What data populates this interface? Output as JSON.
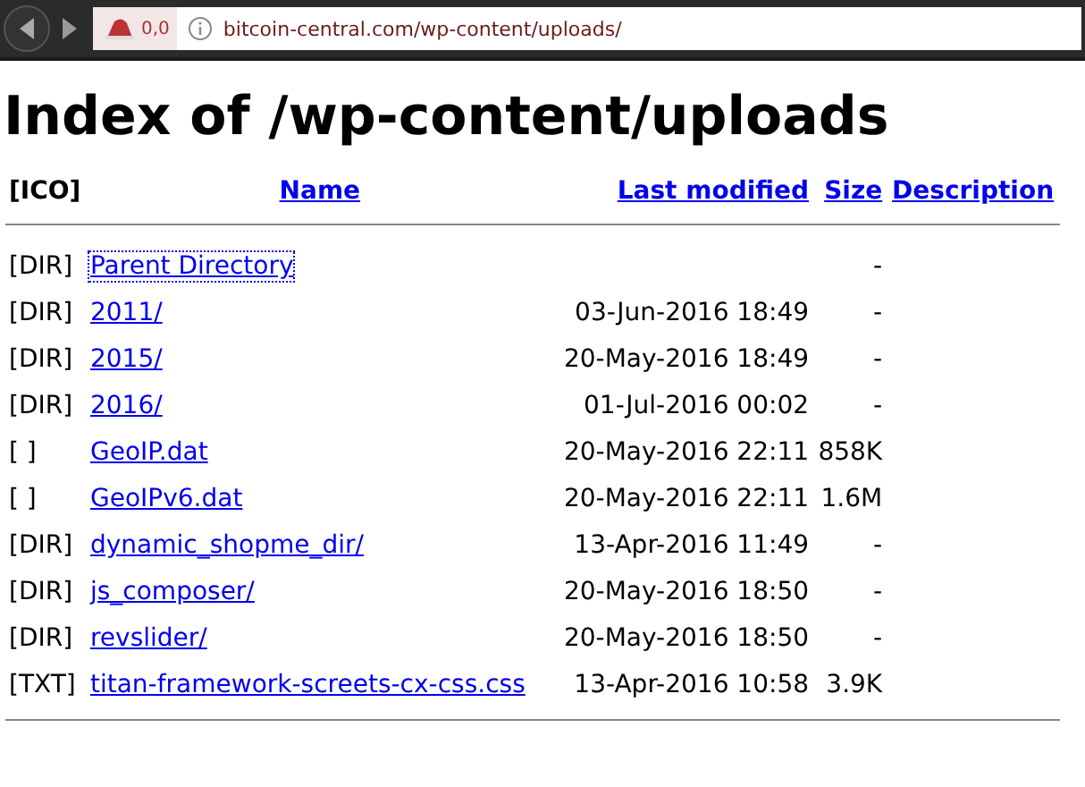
{
  "browser": {
    "counter": "0,0",
    "url": "bitcoin-central.com/wp-content/uploads/"
  },
  "title": "Index of /wp-content/uploads",
  "table": {
    "columns": [
      "[ICO]",
      "Name",
      "Last modified",
      "Size",
      "Description"
    ],
    "rows": [
      {
        "icon": "[DIR]",
        "name": "Parent Directory",
        "modified": "",
        "size": "-",
        "focused": true
      },
      {
        "icon": "[DIR]",
        "name": "2011/",
        "modified": "03-Jun-2016 18:49",
        "size": "-",
        "focused": false
      },
      {
        "icon": "[DIR]",
        "name": "2015/",
        "modified": "20-May-2016 18:49",
        "size": "-",
        "focused": false
      },
      {
        "icon": "[DIR]",
        "name": "2016/",
        "modified": "01-Jul-2016 00:02",
        "size": "-",
        "focused": false
      },
      {
        "icon": "[ ]",
        "name": "GeoIP.dat",
        "modified": "20-May-2016 22:11",
        "size": "858K",
        "focused": false
      },
      {
        "icon": "[ ]",
        "name": "GeoIPv6.dat",
        "modified": "20-May-2016 22:11",
        "size": "1.6M",
        "focused": false
      },
      {
        "icon": "[DIR]",
        "name": "dynamic_shopme_dir/",
        "modified": "13-Apr-2016 11:49",
        "size": "-",
        "focused": false
      },
      {
        "icon": "[DIR]",
        "name": "js_composer/",
        "modified": "20-May-2016 18:50",
        "size": "-",
        "focused": false
      },
      {
        "icon": "[DIR]",
        "name": "revslider/",
        "modified": "20-May-2016 18:50",
        "size": "-",
        "focused": false
      },
      {
        "icon": "[TXT]",
        "name": "titan-framework-screets-cx-css.css",
        "modified": "13-Apr-2016 10:58",
        "size": "3.9K",
        "focused": false
      }
    ]
  }
}
